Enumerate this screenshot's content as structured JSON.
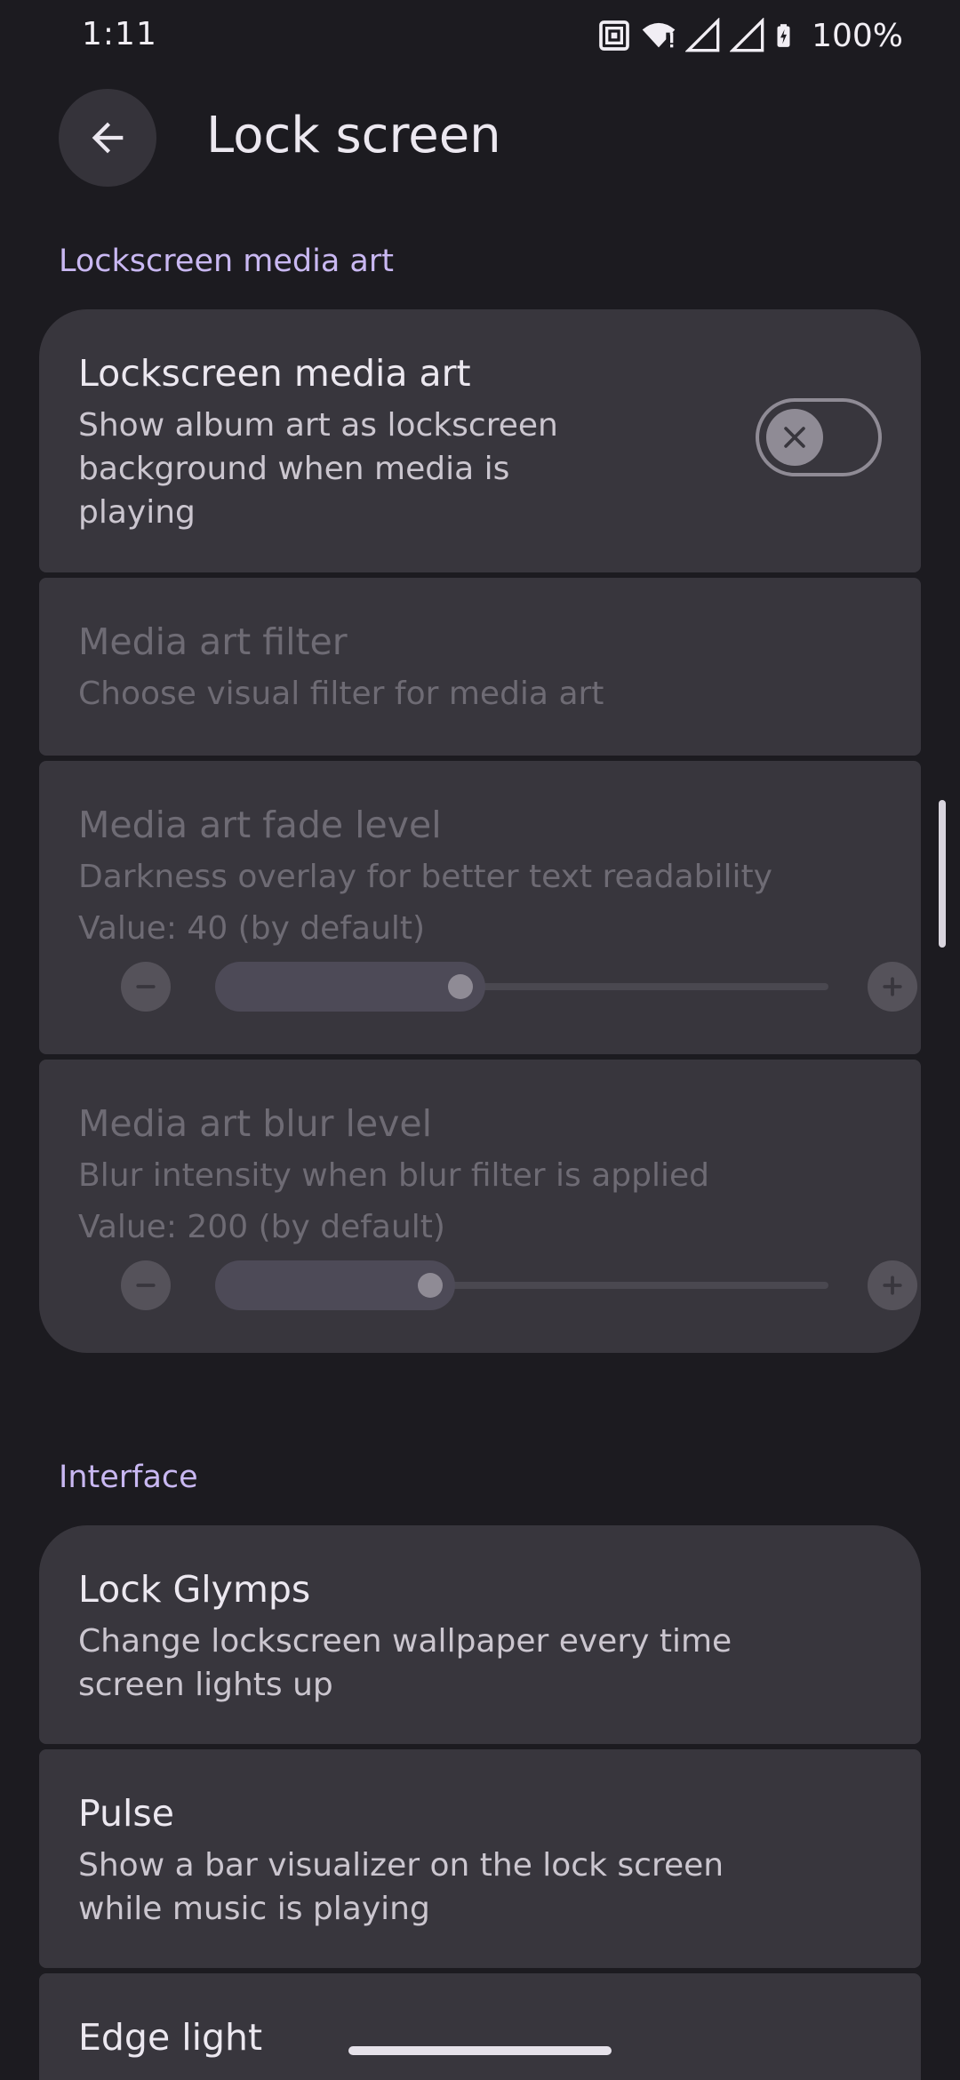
{
  "status_bar": {
    "time": "1:11",
    "battery": "100%",
    "icons": [
      "nfc-icon",
      "wifi-icon",
      "signal-icon",
      "signal-icon",
      "battery-charging-icon"
    ]
  },
  "app_bar": {
    "back_icon": "arrow-back-icon",
    "title": "Lock screen"
  },
  "sections": {
    "media_art": {
      "header": "Lockscreen media art",
      "items": {
        "media_art": {
          "title": "Lockscreen media art",
          "subtitle_lines": [
            "Show album art as lockscreen",
            "background when media is",
            "playing"
          ],
          "toggle_on": false
        },
        "filter": {
          "title": "Media art filter",
          "subtitle": "Choose visual filter for media art"
        },
        "fade": {
          "title": "Media art fade level",
          "subtitle": "Darkness overlay for better text readability",
          "value_text": "Value: 40 (by default)",
          "level": 0.4
        },
        "blur": {
          "title": "Media art blur level",
          "subtitle": "Blur intensity when blur filter is applied",
          "value_text": "Value: 200 (by default)",
          "level": 0.35
        }
      }
    },
    "interface": {
      "header": "Interface",
      "items": {
        "lock_glymps": {
          "title": "Lock Glymps",
          "subtitle_lines": [
            "Change lockscreen wallpaper every time",
            "screen lights up"
          ]
        },
        "pulse": {
          "title": "Pulse",
          "subtitle_lines": [
            "Show a bar visualizer on the lock screen",
            "while music is playing"
          ]
        },
        "edge_light": {
          "title": "Edge light"
        }
      }
    }
  },
  "colors": {
    "background": "#1c1b20",
    "card": "#38363d",
    "accent": "#c9b8f2"
  }
}
